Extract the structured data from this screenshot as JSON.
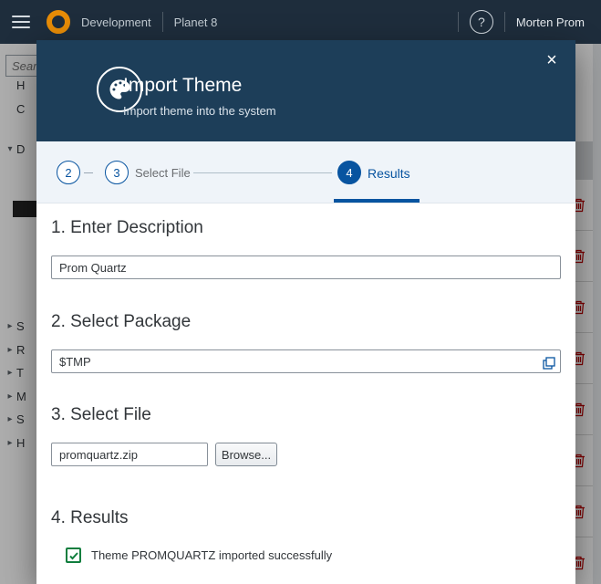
{
  "topbar": {
    "environment": "Development",
    "system": "Planet 8",
    "help": "?",
    "user": "Morten Prom"
  },
  "background": {
    "search_placeholder": "Search",
    "tree_items": [
      "H",
      "C",
      "D",
      "S",
      "R",
      "T",
      "M",
      "S",
      "H"
    ]
  },
  "dialog": {
    "title": "Import Theme",
    "subtitle": "Import theme into the system",
    "close": "×",
    "steps": {
      "step2": "2",
      "step3": "3",
      "step3_label": "Select File",
      "step4": "4",
      "step4_label": "Results"
    },
    "sections": {
      "description": {
        "heading": "1. Enter Description",
        "value": "Prom Quartz"
      },
      "package": {
        "heading": "2. Select Package",
        "value": "$TMP"
      },
      "file": {
        "heading": "3. Select File",
        "value": "promquartz.zip",
        "browse": "Browse..."
      },
      "results": {
        "heading": "4. Results",
        "message": "Theme PROMQUARTZ imported successfully"
      }
    }
  },
  "colors": {
    "accent": "#0854a0",
    "success": "#107e3e",
    "danger": "#bb0000",
    "brand_orange": "#e78c07"
  }
}
